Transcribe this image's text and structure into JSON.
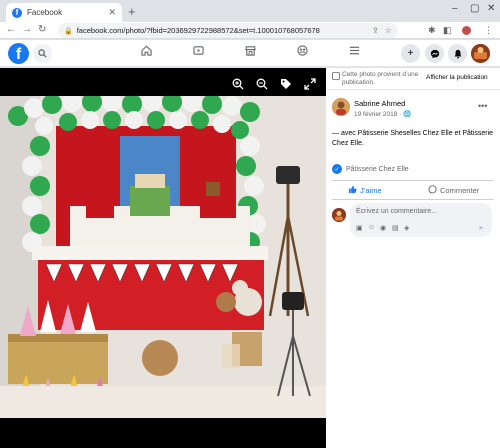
{
  "browser": {
    "tab_title": "Facebook",
    "tab_favicon": "f",
    "url": "facebook.com/photo/?fbid=2036929722988572&set=t.100010768057678"
  },
  "fb": {
    "logo": "f"
  },
  "sidebar": {
    "notice_text": "Cette photo provient d’une publication.",
    "notice_link": "Afficher la publication",
    "author": "Sabrine Ahmed",
    "date": "19 février 2018 · ",
    "caption": "— avec Pâtisserie Sheselles Chez Elle et Pâtisserie Chez Elle.",
    "page_name": "Pâtisserie Chez Elle",
    "like_label": "J’aime",
    "comment_label": "Commenter",
    "comment_placeholder": "Écrivez un commentaire..."
  },
  "colors": {
    "accent": "#1877f2",
    "header_bg": "#ffffff",
    "photo_bg": "#000000"
  },
  "icons": [
    "search-icon",
    "home-icon",
    "video-icon",
    "marketplace-icon",
    "groups-icon",
    "menu-icon",
    "plus-icon",
    "messenger-icon",
    "bell-icon",
    "zoom-in-icon",
    "zoom-out-icon",
    "tag-icon",
    "fullscreen-icon",
    "like-icon",
    "comment-icon",
    "globe-icon"
  ]
}
